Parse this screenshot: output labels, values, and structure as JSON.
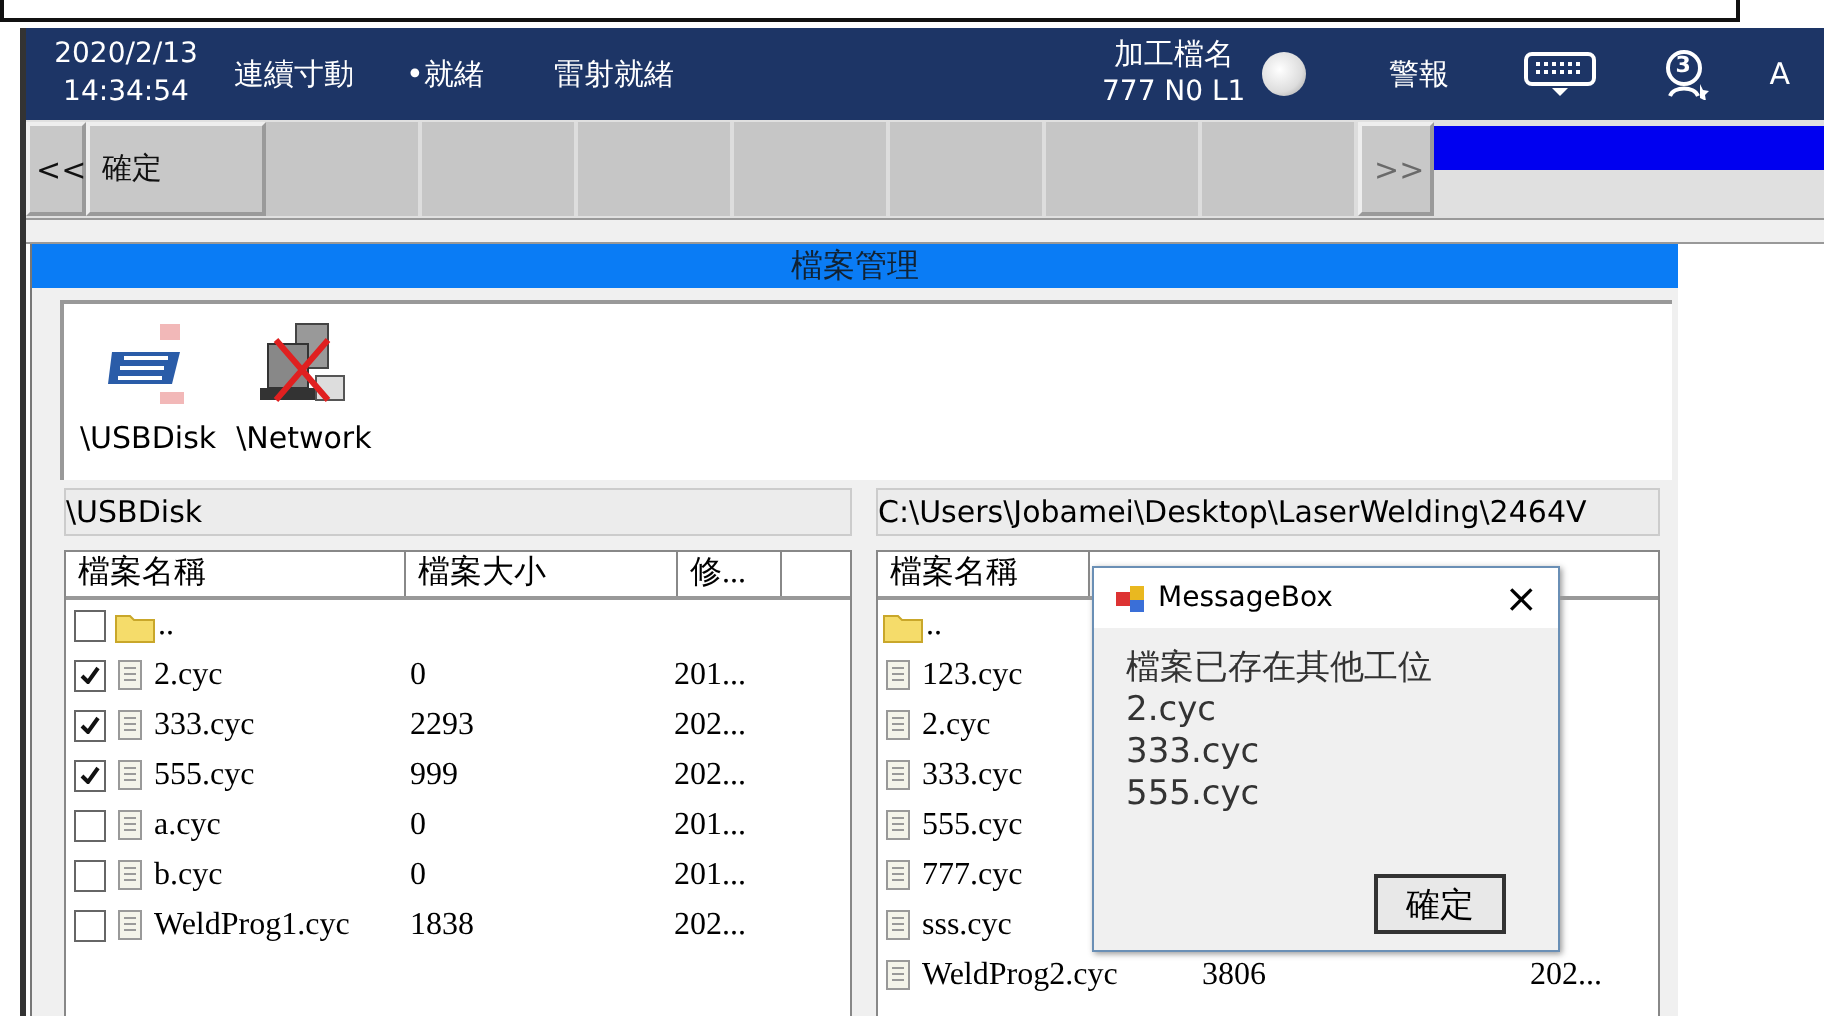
{
  "header": {
    "date": "2020/2/13",
    "time": "14:34:54",
    "statuses": [
      "連續寸動",
      "•就緒",
      "雷射就緒"
    ],
    "file_label": "加工檔名",
    "file_value": "777 N0 L1",
    "lamp_on": true,
    "alarm": "警報",
    "badge": "3",
    "user": "A"
  },
  "toolbar": {
    "prev": "<<",
    "buttons": [
      {
        "kind": "button",
        "label": "確定"
      },
      {
        "kind": "slot"
      },
      {
        "kind": "slot"
      },
      {
        "kind": "slot"
      },
      {
        "kind": "slot"
      },
      {
        "kind": "slot"
      },
      {
        "kind": "slot"
      },
      {
        "kind": "slot"
      }
    ],
    "next": ">>",
    "next_disabled": true
  },
  "dialog": {
    "title": "檔案管理",
    "drives": [
      {
        "kind": "usb",
        "label": "\\USBDisk"
      },
      {
        "kind": "network",
        "label": "\\Network"
      }
    ],
    "left": {
      "path": "\\USBDisk",
      "columns": [
        "檔案名稱",
        "檔案大小",
        "修..."
      ],
      "rows": [
        {
          "kind": "folder",
          "name": "..",
          "checked": false
        },
        {
          "kind": "file",
          "name": "2.cyc",
          "size": "0",
          "date": "201...",
          "checked": true
        },
        {
          "kind": "file",
          "name": "333.cyc",
          "size": "2293",
          "date": "202...",
          "checked": true
        },
        {
          "kind": "file",
          "name": "555.cyc",
          "size": "999",
          "date": "202...",
          "checked": true
        },
        {
          "kind": "file",
          "name": "a.cyc",
          "size": "0",
          "date": "201...",
          "checked": false
        },
        {
          "kind": "file",
          "name": "b.cyc",
          "size": "0",
          "date": "201...",
          "checked": false
        },
        {
          "kind": "file",
          "name": "WeldProg1.cyc",
          "size": "1838",
          "date": "202...",
          "checked": false
        }
      ]
    },
    "right": {
      "path": "C:\\Users\\Jobamei\\Desktop\\LaserWelding\\2464V",
      "columns": [
        "檔案名稱"
      ],
      "rows": [
        {
          "kind": "folder",
          "name": ".."
        },
        {
          "kind": "file",
          "name": "123.cyc"
        },
        {
          "kind": "file",
          "name": "2.cyc"
        },
        {
          "kind": "file",
          "name": "333.cyc"
        },
        {
          "kind": "file",
          "name": "555.cyc"
        },
        {
          "kind": "file",
          "name": "777.cyc"
        },
        {
          "kind": "file",
          "name": "sss.cyc"
        },
        {
          "kind": "file",
          "name": "WeldProg2.cyc",
          "size": "3806",
          "date": "202..."
        }
      ]
    }
  },
  "message_box": {
    "title": "MessageBox",
    "close": "×",
    "lines": [
      "檔案已存在其他工位",
      "2.cyc",
      "333.cyc",
      "555.cyc"
    ],
    "button": "確定"
  }
}
